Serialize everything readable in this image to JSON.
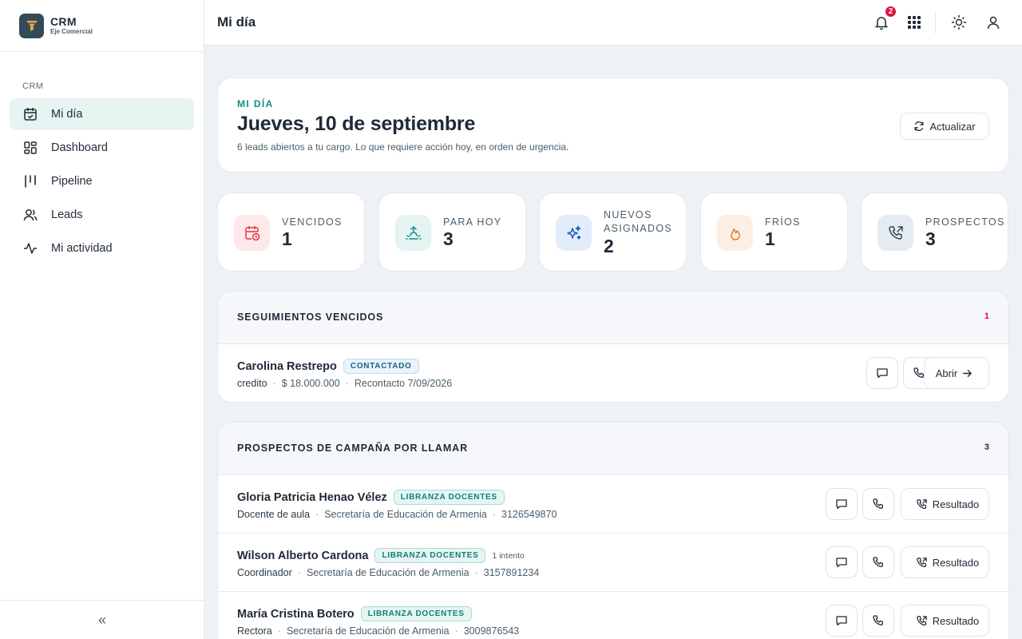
{
  "sidebar": {
    "brand_title": "CRM",
    "brand_subtitle": "Eje Comercial",
    "section_label": "CRM",
    "items": [
      {
        "label": "Mi día",
        "icon": "calendar-check-icon",
        "active": true
      },
      {
        "label": "Dashboard",
        "icon": "dashboard-icon"
      },
      {
        "label": "Pipeline",
        "icon": "pipeline-icon"
      },
      {
        "label": "Leads",
        "icon": "users-icon"
      },
      {
        "label": "Mi actividad",
        "icon": "activity-icon"
      }
    ],
    "collapse_label": "«"
  },
  "header": {
    "title": "Mi día",
    "notification_count": "2",
    "icons": [
      "bell-icon",
      "apps-grid-icon",
      "sun-icon",
      "user-icon"
    ]
  },
  "hero": {
    "eyebrow": "MI DÍA",
    "title": "Jueves, 10 de septiembre",
    "subtitle": "6 leads abiertos a tu cargo. Lo que requiere acción hoy, en orden de urgencia.",
    "refresh_label": "Actualizar"
  },
  "stats": [
    {
      "label": "VENCIDOS",
      "value": "1",
      "icon": "calendar-clock-icon",
      "color": "#e2373c",
      "bg": "#fde9ea"
    },
    {
      "label": "PARA HOY",
      "value": "3",
      "icon": "sunrise-icon",
      "color": "#0f8f8a",
      "bg": "#e3f4f2"
    },
    {
      "label": "NUEVOS ASIGNADOS",
      "label_line1": "NUEVOS",
      "label_line2": "ASIGNADOS",
      "value": "2",
      "icon": "sparkles-icon",
      "color": "#1d5bc4",
      "bg": "#e2ecfb"
    },
    {
      "label": "FRÍOS",
      "value": "1",
      "icon": "flame-icon",
      "color": "#e07b39",
      "bg": "#fdeee3"
    },
    {
      "label": "PROSPECTOS",
      "value": "3",
      "icon": "phone-outgoing-icon",
      "color": "#334a58",
      "bg": "#e6ebef"
    }
  ],
  "overdue": {
    "title": "SEGUIMIENTOS VENCIDOS",
    "count": "1",
    "count_color": "#e0103d",
    "rows": [
      {
        "name": "Carolina Restrepo",
        "tag": "CONTACTADO",
        "meta": [
          "credito",
          "$ 18.000.000",
          "Recontacto 7/09/2026"
        ],
        "action": "Abrir"
      }
    ]
  },
  "prospects": {
    "title": "PROSPECTOS DE CAMPAÑA POR LLAMAR",
    "count": "3",
    "count_color": "#1f2a37",
    "action_label": "Resultado",
    "rows": [
      {
        "name": "Gloria Patricia Henao Vélez",
        "tag": "LIBRANZA DOCENTES",
        "attempt": "",
        "meta": [
          "Docente de aula",
          "Secretaría de Educación de Armenia",
          "3126549870"
        ]
      },
      {
        "name": "Wilson Alberto Cardona",
        "tag": "LIBRANZA DOCENTES",
        "attempt": "1 intento",
        "meta": [
          "Coordinador",
          "Secretaría de Educación de Armenia",
          "3157891234"
        ]
      },
      {
        "name": "María Cristina Botero",
        "tag": "LIBRANZA DOCENTES",
        "attempt": "",
        "meta": [
          "Rectora",
          "Secretaría de Educación de Armenia",
          "3009876543"
        ]
      }
    ]
  }
}
